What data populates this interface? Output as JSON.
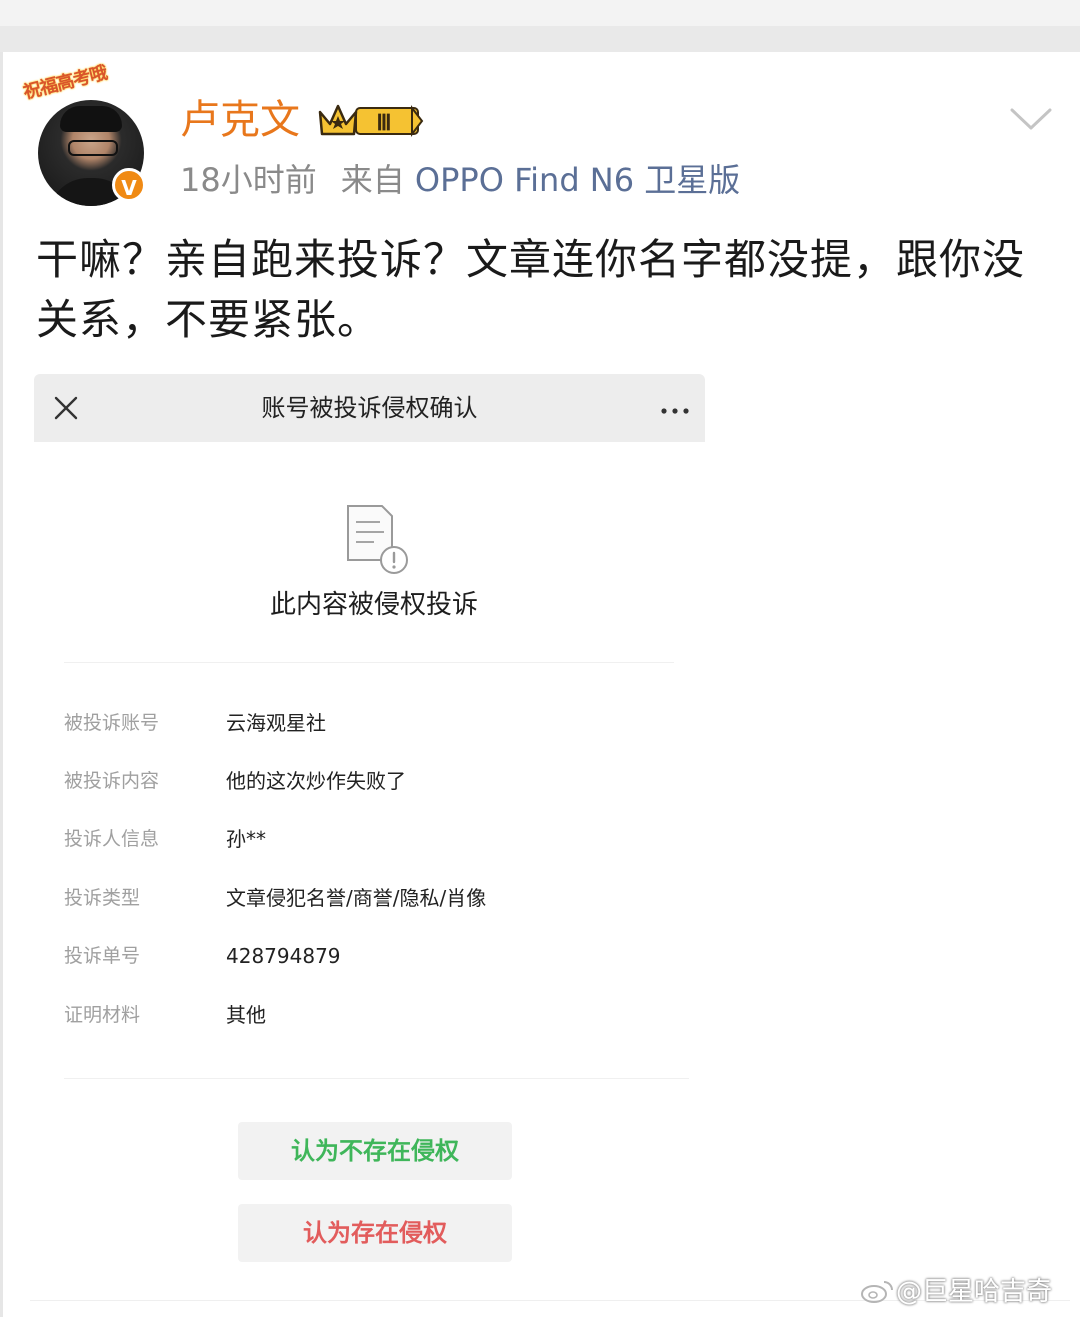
{
  "post": {
    "author": "卢克文",
    "avatar_banner": "祝福高考哦",
    "vip_level": "Ⅲ",
    "verified_mark": "V",
    "time": "18小时前",
    "from_label": "来自",
    "device": "OPPO Find N6 卫星版",
    "text": "干嘛？亲自跑来投诉？文章连你名字都没提，跟你没关系，不要紧张。"
  },
  "embed": {
    "title": "账号被投诉侵权确认",
    "heading": "此内容被侵权投诉",
    "details": [
      {
        "label": "被投诉账号",
        "value": "云海观星社"
      },
      {
        "label": "被投诉内容",
        "value": "他的这次炒作失败了"
      },
      {
        "label": "投诉人信息",
        "value": "孙**"
      },
      {
        "label": "投诉类型",
        "value": "文章侵犯名誉/商誉/隐私/肖像"
      },
      {
        "label": "投诉单号",
        "value": "428794879"
      },
      {
        "label": "证明材料",
        "value": "其他"
      }
    ],
    "buttons": {
      "no_infringement": "认为不存在侵权",
      "infringement": "认为存在侵权"
    }
  },
  "watermark": "@巨星哈吉奇",
  "colors": {
    "author": "#e8771c",
    "device_link": "#5b6f96",
    "green_action": "#3fb65a",
    "red_action": "#e25c5c",
    "verified_badge": "#f08a14"
  },
  "icons": [
    "chevron-down-icon",
    "close-icon",
    "more-icon",
    "doc-warning-icon",
    "verified-icon",
    "crown-icon",
    "weibo-logo-icon"
  ]
}
